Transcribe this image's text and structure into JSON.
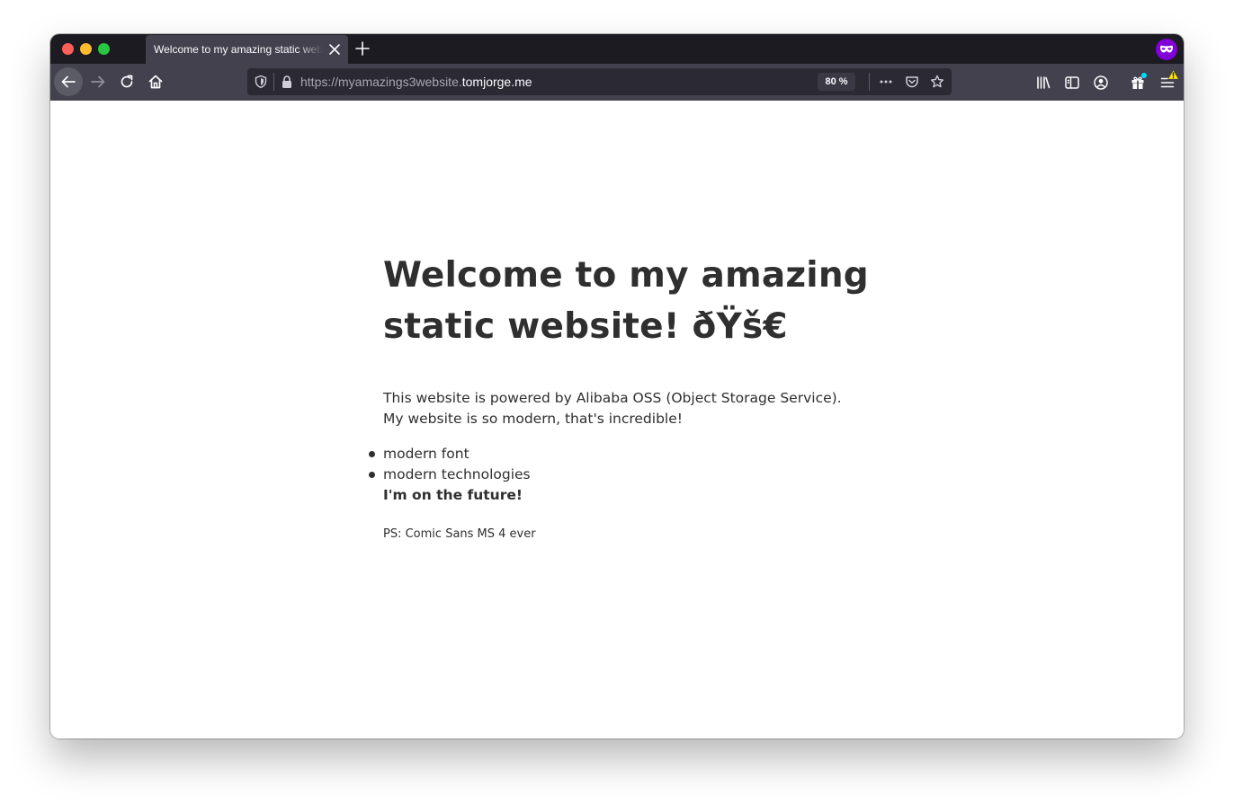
{
  "browser": {
    "tab": {
      "title": "Welcome to my amazing static website! ðŸš€"
    },
    "url": {
      "prefix": "https://myamazings3website.",
      "domain": "tomjorge.me"
    },
    "zoom_label": "80 %"
  },
  "page": {
    "heading": "Welcome to my amazing static website! ðŸš€",
    "intro_line1": "This website is powered by Alibaba OSS (Object Storage Service).",
    "intro_line2": "My website is so modern, that's incredible!",
    "list": [
      "modern font",
      "modern technologies"
    ],
    "strong_line": "I'm on the future!",
    "ps": "PS: Comic Sans MS 4 ever"
  },
  "colors": {
    "tabstrip": "#1c1b22",
    "toolbar": "#42414d",
    "urlbar": "#2b2a33",
    "private_badge": "#8000d7",
    "text": "#2f2f2f"
  }
}
